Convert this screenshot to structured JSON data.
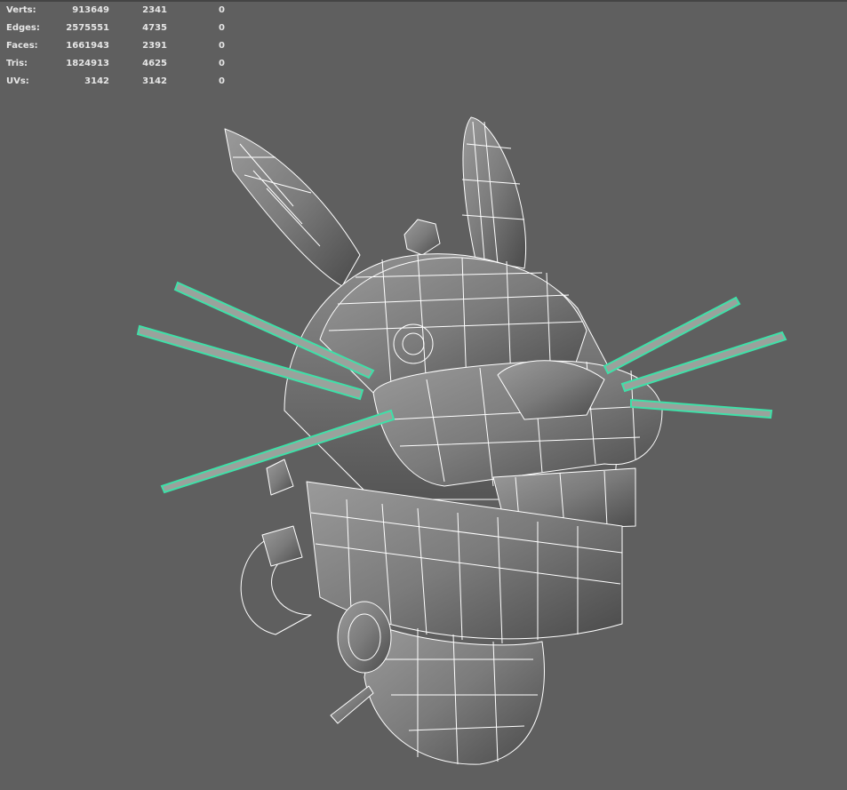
{
  "hud": {
    "rows": [
      {
        "label": "Verts:",
        "scene": "913649",
        "selected": "2341",
        "components": "0"
      },
      {
        "label": "Edges:",
        "scene": "2575551",
        "selected": "4735",
        "components": "0"
      },
      {
        "label": "Faces:",
        "scene": "1661943",
        "selected": "2391",
        "components": "0"
      },
      {
        "label": "Tris:",
        "scene": "1824913",
        "selected": "4625",
        "components": "0"
      },
      {
        "label": "UVs:",
        "scene": "3142",
        "selected": "3142",
        "components": "0"
      }
    ]
  },
  "viewport": {
    "background_color": "#5f5f5f",
    "wireframe_color": "#ffffff",
    "selection_color": "#3fe0a8"
  }
}
